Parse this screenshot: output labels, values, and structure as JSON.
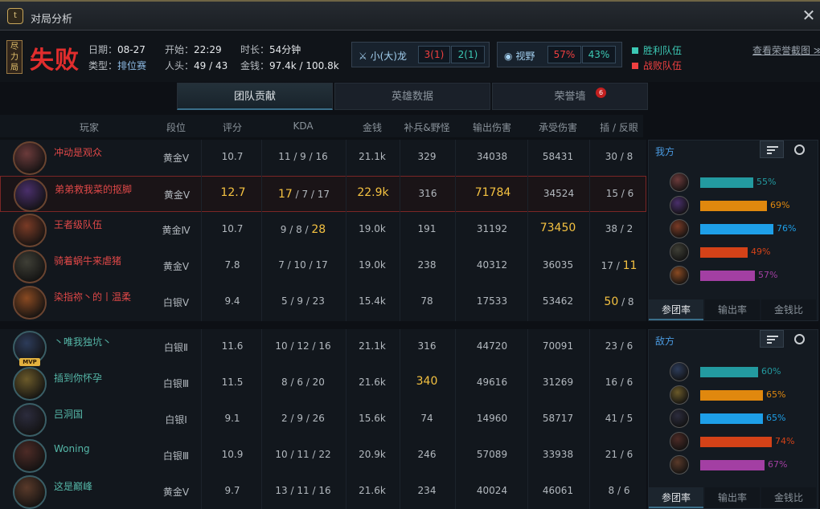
{
  "window": {
    "title": "对局分析",
    "logo_text": "t"
  },
  "summary": {
    "mode_tag": "尽力局",
    "result": "失败",
    "date_label": "日期：",
    "date": "08-27",
    "type_label": "类型：",
    "type": "排位赛",
    "start_label": "开始：",
    "start": "22:29",
    "kills_label": "人头：",
    "kills": "49 / 43",
    "duration_label": "时长：",
    "duration": "54分钟",
    "gold_label": "金钱：",
    "gold": "97.4k / 100.8k",
    "dragon": {
      "label": "小(大)龙",
      "ours": "3(1)",
      "theirs": "2(1)"
    },
    "vision": {
      "label": "视野",
      "ours": "57%",
      "theirs": "43%"
    },
    "legend_win": "胜利队伍",
    "legend_lose": "战败队伍",
    "honor_link": "查看荣誉截图 ≫",
    "colors": {
      "win": "#3cc8b4",
      "lose": "#ef4040"
    }
  },
  "tabs": [
    {
      "label": "团队贡献",
      "active": true
    },
    {
      "label": "英雄数据",
      "active": false
    },
    {
      "label": "荣誉墙",
      "active": false,
      "badge": "6"
    }
  ],
  "columns": [
    "玩家",
    "段位",
    "评分",
    "KDA",
    "金钱",
    "补兵&野怪",
    "输出伤害",
    "承受伤害",
    "插 / 反眼"
  ],
  "my_team": [
    {
      "name": "冲动是观众",
      "rank": "黄金Ⅴ",
      "score": "10.7",
      "k": "11",
      "d": "9",
      "a": "16",
      "gold": "21.1k",
      "cs": "329",
      "dmg": "34038",
      "taken": "58431",
      "wp": "30",
      "wk": "8",
      "avatar": "#6c3b3b"
    },
    {
      "name": "弟弟救我菜的抠脚",
      "rank": "黄金Ⅴ",
      "score": "12.7",
      "k": "17",
      "d": "7",
      "a": "17",
      "gold": "22.9k",
      "cs": "316",
      "dmg": "71784",
      "taken": "34524",
      "wp": "15",
      "wk": "6",
      "avatar": "#4a2f6b"
    },
    {
      "name": "王者级队伍",
      "rank": "黄金Ⅳ",
      "score": "10.7",
      "k": "9",
      "d": "8",
      "a": "28",
      "gold": "19.0k",
      "cs": "191",
      "dmg": "31192",
      "taken": "73450",
      "wp": "38",
      "wk": "2",
      "avatar": "#7a3b26"
    },
    {
      "name": "骑着蜗牛来虐猪",
      "rank": "黄金Ⅴ",
      "score": "7.8",
      "k": "7",
      "d": "10",
      "a": "17",
      "gold": "19.0k",
      "cs": "238",
      "dmg": "40312",
      "taken": "36035",
      "wp": "17",
      "wk": "11",
      "avatar": "#3f3f36"
    },
    {
      "name": "染指祢丶的丨温柔",
      "rank": "白银Ⅴ",
      "score": "9.4",
      "k": "5",
      "d": "9",
      "a": "23",
      "gold": "15.4k",
      "cs": "78",
      "dmg": "17533",
      "taken": "53462",
      "wp": "50",
      "wk": "8",
      "avatar": "#8a4a22"
    }
  ],
  "enemy_team": [
    {
      "name": "丶唯我独坑丶",
      "rank": "白银Ⅱ",
      "score": "11.6",
      "k": "10",
      "d": "12",
      "a": "16",
      "gold": "21.1k",
      "cs": "316",
      "dmg": "44720",
      "taken": "70091",
      "wp": "23",
      "wk": "6",
      "avatar": "#2d3c5a",
      "mvp": "MVP"
    },
    {
      "name": "插到你怀孕",
      "rank": "白银Ⅲ",
      "score": "11.5",
      "k": "8",
      "d": "6",
      "a": "20",
      "gold": "21.6k",
      "cs": "340",
      "dmg": "49616",
      "taken": "31269",
      "wp": "16",
      "wk": "6",
      "avatar": "#6b5a2a"
    },
    {
      "name": "吕洞国",
      "rank": "白银Ⅰ",
      "score": "9.1",
      "k": "2",
      "d": "9",
      "a": "26",
      "gold": "15.6k",
      "cs": "74",
      "dmg": "14960",
      "taken": "58717",
      "wp": "41",
      "wk": "5",
      "avatar": "#2c2c3d"
    },
    {
      "name": "Woning",
      "rank": "白银Ⅲ",
      "score": "10.9",
      "k": "10",
      "d": "11",
      "a": "22",
      "gold": "20.9k",
      "cs": "246",
      "dmg": "57089",
      "taken": "33938",
      "wp": "21",
      "wk": "6",
      "avatar": "#4d2b26"
    },
    {
      "name": "这是巅峰",
      "rank": "黄金Ⅴ",
      "score": "9.7",
      "k": "13",
      "d": "11",
      "a": "16",
      "gold": "21.6k",
      "cs": "234",
      "dmg": "40024",
      "taken": "46061",
      "wp": "8",
      "wk": "6",
      "avatar": "#5a3a2a"
    }
  ],
  "panels": {
    "ours_title": "我方",
    "enemy_title": "敌方",
    "tabs": [
      "参团率",
      "输出率",
      "金钱比"
    ],
    "bar_colors": [
      "#239aa0",
      "#e0880e",
      "#1e9fe8",
      "#d44218",
      "#a33fa3"
    ],
    "ours_values": [
      55,
      69,
      76,
      49,
      57
    ],
    "enemy_values": [
      60,
      65,
      65,
      74,
      67
    ]
  }
}
